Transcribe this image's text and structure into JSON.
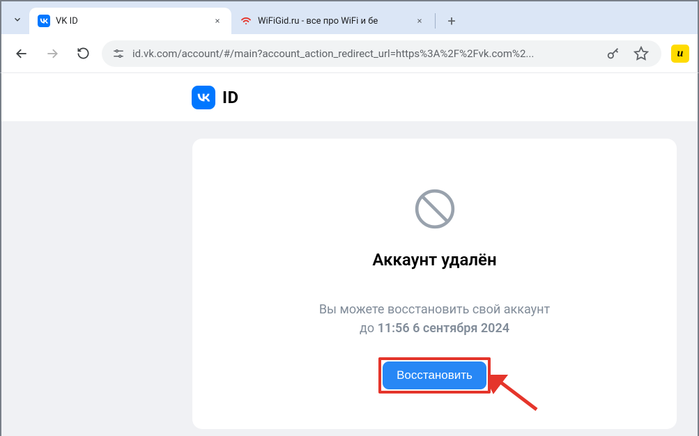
{
  "browser": {
    "tabs": [
      {
        "title": "VK ID",
        "favicon": "vk"
      },
      {
        "title": "WiFiGid.ru - все про WiFi и бе",
        "favicon": "wifi"
      }
    ],
    "url": "id.vk.com/account/#/main?account_action_redirect_url=https%3A%2F%2Fvk.com%2..."
  },
  "header": {
    "brand": "ID"
  },
  "card": {
    "title": "Аккаунт удалён",
    "desc_line1": "Вы можете восстановить свой аккаунт",
    "desc_line2_prefix": "до ",
    "desc_line2_strong": "11:56 6 сентября 2024",
    "restore_label": "Восстановить"
  }
}
